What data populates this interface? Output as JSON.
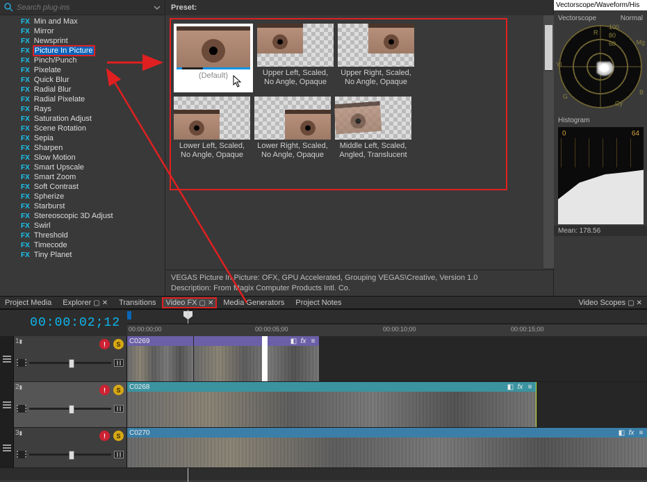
{
  "search": {
    "placeholder": "Search plug-ins"
  },
  "fx_prefix": "FX",
  "fx_list": [
    "Min and Max",
    "Mirror",
    "Newsprint",
    "Picture In Picture",
    "Pinch/Punch",
    "Pixelate",
    "Quick Blur",
    "Radial Blur",
    "Radial Pixelate",
    "Rays",
    "Saturation Adjust",
    "Scene Rotation",
    "Sepia",
    "Sharpen",
    "Slow Motion",
    "Smart Upscale",
    "Smart Zoom",
    "Soft Contrast",
    "Spherize",
    "Starburst",
    "Stereoscopic 3D Adjust",
    "Swirl",
    "Threshold",
    "Timecode",
    "Tiny Planet"
  ],
  "selected_fx_index": 3,
  "preset_header": "Preset:",
  "presets": [
    {
      "label": "(Default)",
      "pos": "full",
      "selected": true
    },
    {
      "label": "Upper Left, Scaled, No Angle, Opaque",
      "pos": "ul"
    },
    {
      "label": "Upper Right, Scaled, No Angle, Opaque",
      "pos": "ur"
    },
    {
      "label": "Lower Left, Scaled, No Angle, Opaque",
      "pos": "ll"
    },
    {
      "label": "Lower Right, Scaled, No Angle, Opaque",
      "pos": "lr"
    },
    {
      "label": "Middle Left, Scaled, Angled, Translucent",
      "pos": "ml"
    }
  ],
  "description": {
    "line1": "VEGAS Picture In Picture: OFX, GPU Accelerated, Grouping VEGAS\\Creative, Version 1.0",
    "line2": "Description: From Magix Computer Products Intl. Co."
  },
  "tabs": {
    "project_media": "Project Media",
    "explorer": "Explorer",
    "transitions": "Transitions",
    "video_fx": "Video FX",
    "media_generators": "Media Generators",
    "project_notes": "Project Notes",
    "video_scopes": "Video Scopes"
  },
  "scopes": {
    "top_tabs": "Vectorscope/Waveform/His",
    "vectorscope_label": "Vectorscope",
    "vectorscope_mode": "Normal",
    "vs_ticks": [
      "100",
      "80",
      "60",
      "R",
      "Mg",
      "YI",
      "B",
      "Cy",
      "G"
    ],
    "histogram_label": "Histogram",
    "hist_ticks": {
      "a": "0",
      "b": "64"
    },
    "mean": "Mean: 178.56"
  },
  "timeline": {
    "timecode": "00:00:02;12",
    "ruler": [
      "00:00:00;00",
      "00:00:05;00",
      "00:00:10;00",
      "00:00:15;00"
    ],
    "tracks": [
      {
        "num": "1",
        "clip": "C0269",
        "type": "video",
        "style": "clip1"
      },
      {
        "num": "2",
        "clip": "C0268",
        "type": "video",
        "style": "clip2",
        "selected": true
      },
      {
        "num": "3",
        "clip": "C0270",
        "type": "video",
        "style": "clip3"
      }
    ],
    "mute_glyph": "!",
    "solo_glyph": "S"
  }
}
